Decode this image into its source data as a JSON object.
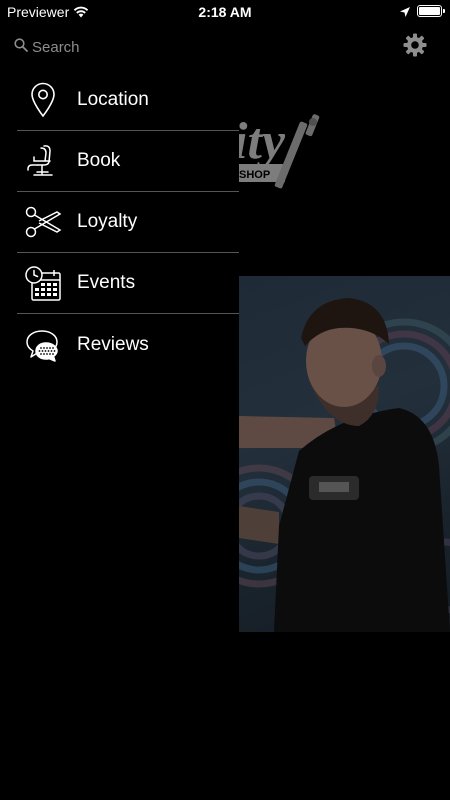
{
  "status_bar": {
    "carrier": "Previewer",
    "time": "2:18 AM"
  },
  "search": {
    "placeholder": "Search"
  },
  "menu": {
    "items": [
      {
        "label": "Location",
        "icon": "location-pin-icon"
      },
      {
        "label": "Book",
        "icon": "barber-chair-icon"
      },
      {
        "label": "Loyalty",
        "icon": "scissors-icon"
      },
      {
        "label": "Events",
        "icon": "calendar-clock-icon"
      },
      {
        "label": "Reviews",
        "icon": "chat-bubbles-icon"
      }
    ]
  },
  "background": {
    "logo_text": "ity",
    "logo_subtext": "SHOP"
  },
  "colors": {
    "background": "#000000",
    "text": "#ffffff",
    "placeholder": "#8e8e8e",
    "divider": "#555555"
  }
}
